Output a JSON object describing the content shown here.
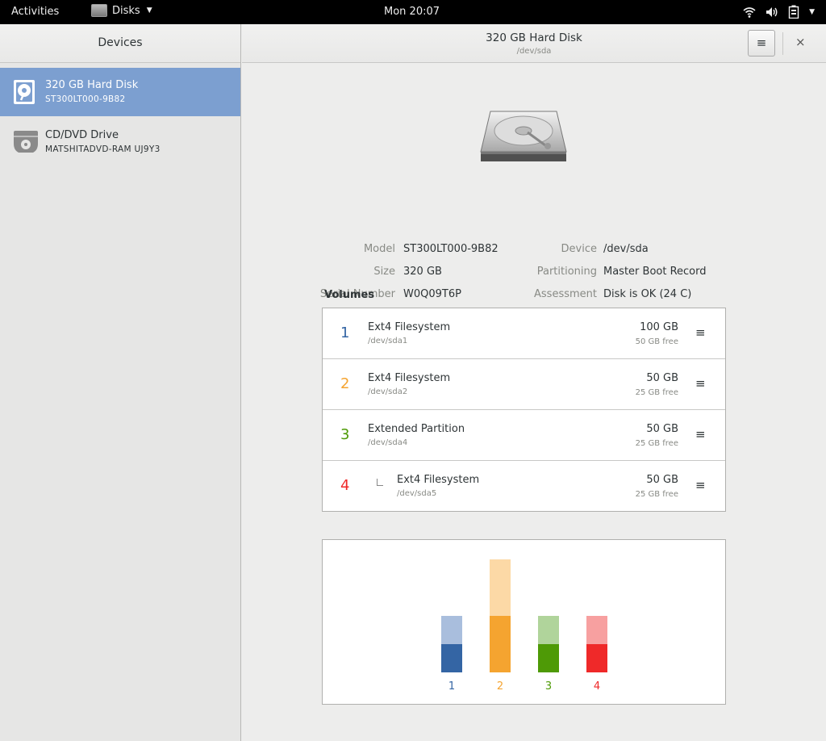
{
  "topbar": {
    "activities": "Activities",
    "app_name": "Disks",
    "clock": "Mon 20:07"
  },
  "sidebar": {
    "header": "Devices",
    "devices": [
      {
        "title": "320 GB Hard Disk",
        "subtitle": "ST300LT000-9B82"
      },
      {
        "title": "CD/DVD Drive",
        "subtitle": "MATSHITADVD-RAM UJ9Y3"
      }
    ]
  },
  "header": {
    "title": "320 GB Hard Disk",
    "subtitle": "/dev/sda",
    "menu_icon": "≡",
    "close_icon": "×"
  },
  "info": {
    "model_label": "Model",
    "model": "ST300LT000-9B82",
    "size_label": "Size",
    "size": "320 GB",
    "serial_label": "Serial Number",
    "serial": "W0Q09T6P",
    "device_label": "Device",
    "device": "/dev/sda",
    "partitioning_label": "Partitioning",
    "partitioning": "Master Boot Record",
    "assessment_label": "Assessment",
    "assessment": "Disk is OK (24 C)"
  },
  "volumes": {
    "title": "Volumes",
    "items": [
      {
        "num": "1",
        "name": "Ext4 Filesystem",
        "dev": "/dev/sda1",
        "size": "100 GB",
        "free": "50 GB free",
        "color": "#3465a4"
      },
      {
        "num": "2",
        "name": "Ext4 Filesystem",
        "dev": "/dev/sda2",
        "size": "50 GB",
        "free": "25 GB free",
        "color": "#f5a430"
      },
      {
        "num": "3",
        "name": "Extended Partition",
        "dev": "/dev/sda4",
        "size": "50 GB",
        "free": "25 GB free",
        "color": "#4e9a06"
      },
      {
        "num": "4",
        "name": "Ext4 Filesystem",
        "dev": "/dev/sda5",
        "size": "50 GB",
        "free": "25 GB free",
        "color": "#ef2929"
      }
    ]
  },
  "chart_data": {
    "type": "bar",
    "categories": [
      "1",
      "2",
      "3",
      "4"
    ],
    "colors": [
      "#3465a4",
      "#f5a430",
      "#4e9a06",
      "#ef2929"
    ],
    "light_colors": [
      "#a9bedd",
      "#fcd9a6",
      "#b0d49b",
      "#f7a0a0"
    ],
    "used": [
      0.5,
      1.0,
      0.5,
      0.5
    ],
    "total": [
      1.0,
      2.0,
      1.0,
      1.0
    ],
    "ylim": [
      0,
      2
    ]
  }
}
